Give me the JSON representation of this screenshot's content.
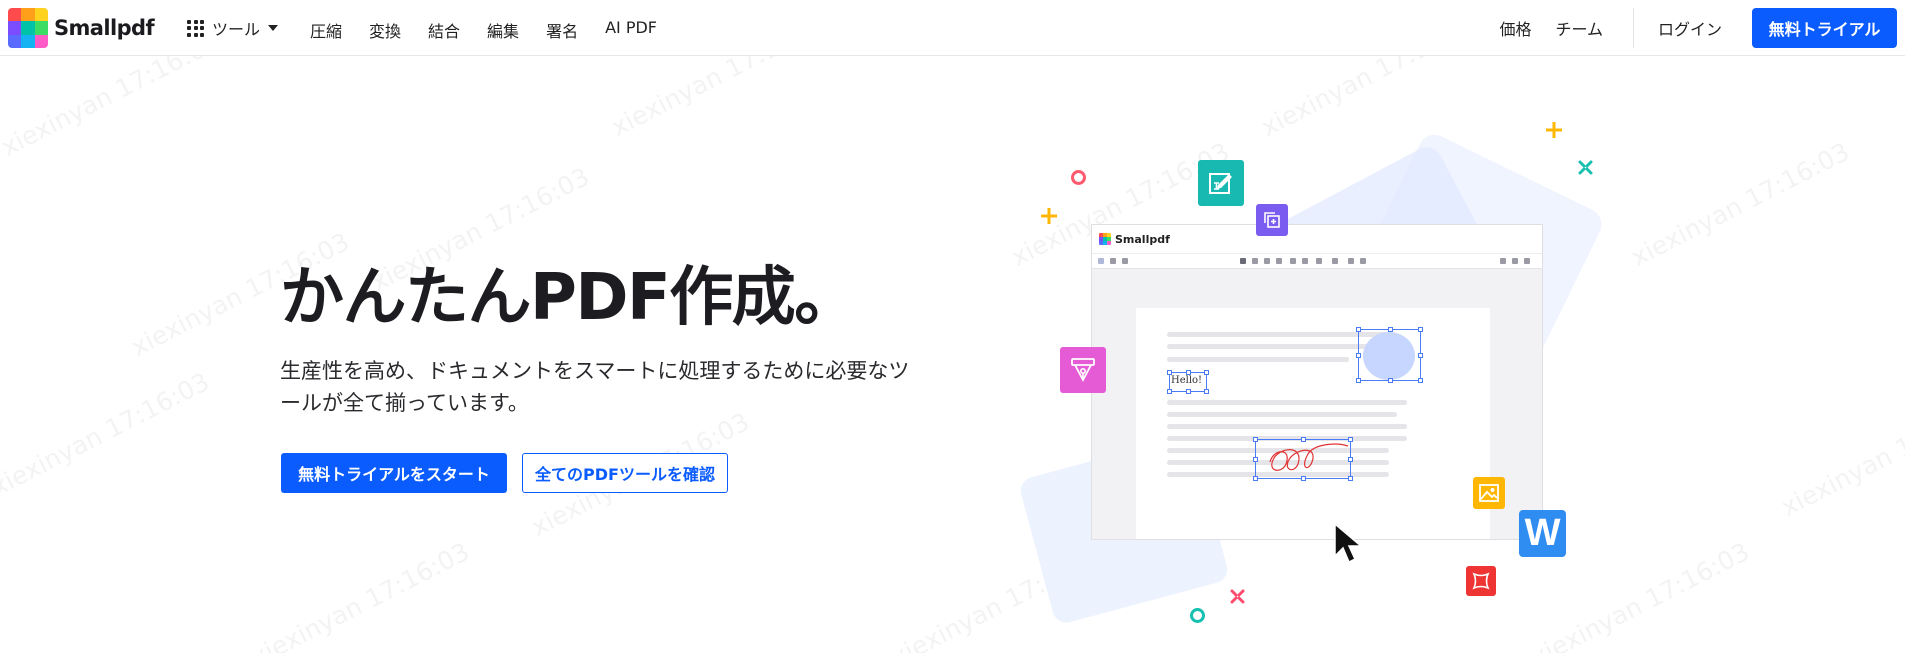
{
  "header": {
    "logo_text": "Smallpdf",
    "tools_label": "ツール",
    "nav": [
      "圧縮",
      "変換",
      "結合",
      "編集",
      "署名",
      "AI PDF"
    ],
    "pricing": "価格",
    "team": "チーム",
    "login": "ログイン",
    "cta": "無料トライアル"
  },
  "hero": {
    "title": "かんたんPDF作成。",
    "description": "生産性を高め、ドキュメントをスマートに処理するために必要なツールが全て揃っています。",
    "primary_button": "無料トライアルをスタート",
    "secondary_button": "全てのPDFツールを確認"
  },
  "illustration": {
    "app_name": "Smallpdf",
    "text_box": "Hello!",
    "word_icon_letter": "W"
  },
  "watermark": {
    "user": "xiexinyan",
    "time": "17:16:03"
  },
  "colors": {
    "accent": "#0b5cff",
    "logo_cells": [
      "#ff4b4b",
      "#ff9f1a",
      "#ffd21f",
      "#7b4dff",
      "#00c2a8",
      "#3ddc65",
      "#5b6bff",
      "#16b3f2",
      "#ff5cc8"
    ],
    "icon_teal": "#17b9b0",
    "icon_purple": "#7b5cf0",
    "icon_magenta": "#e55bd6",
    "icon_yellow": "#ffb703",
    "icon_blue": "#2f8cf0",
    "icon_red": "#ef3434"
  }
}
